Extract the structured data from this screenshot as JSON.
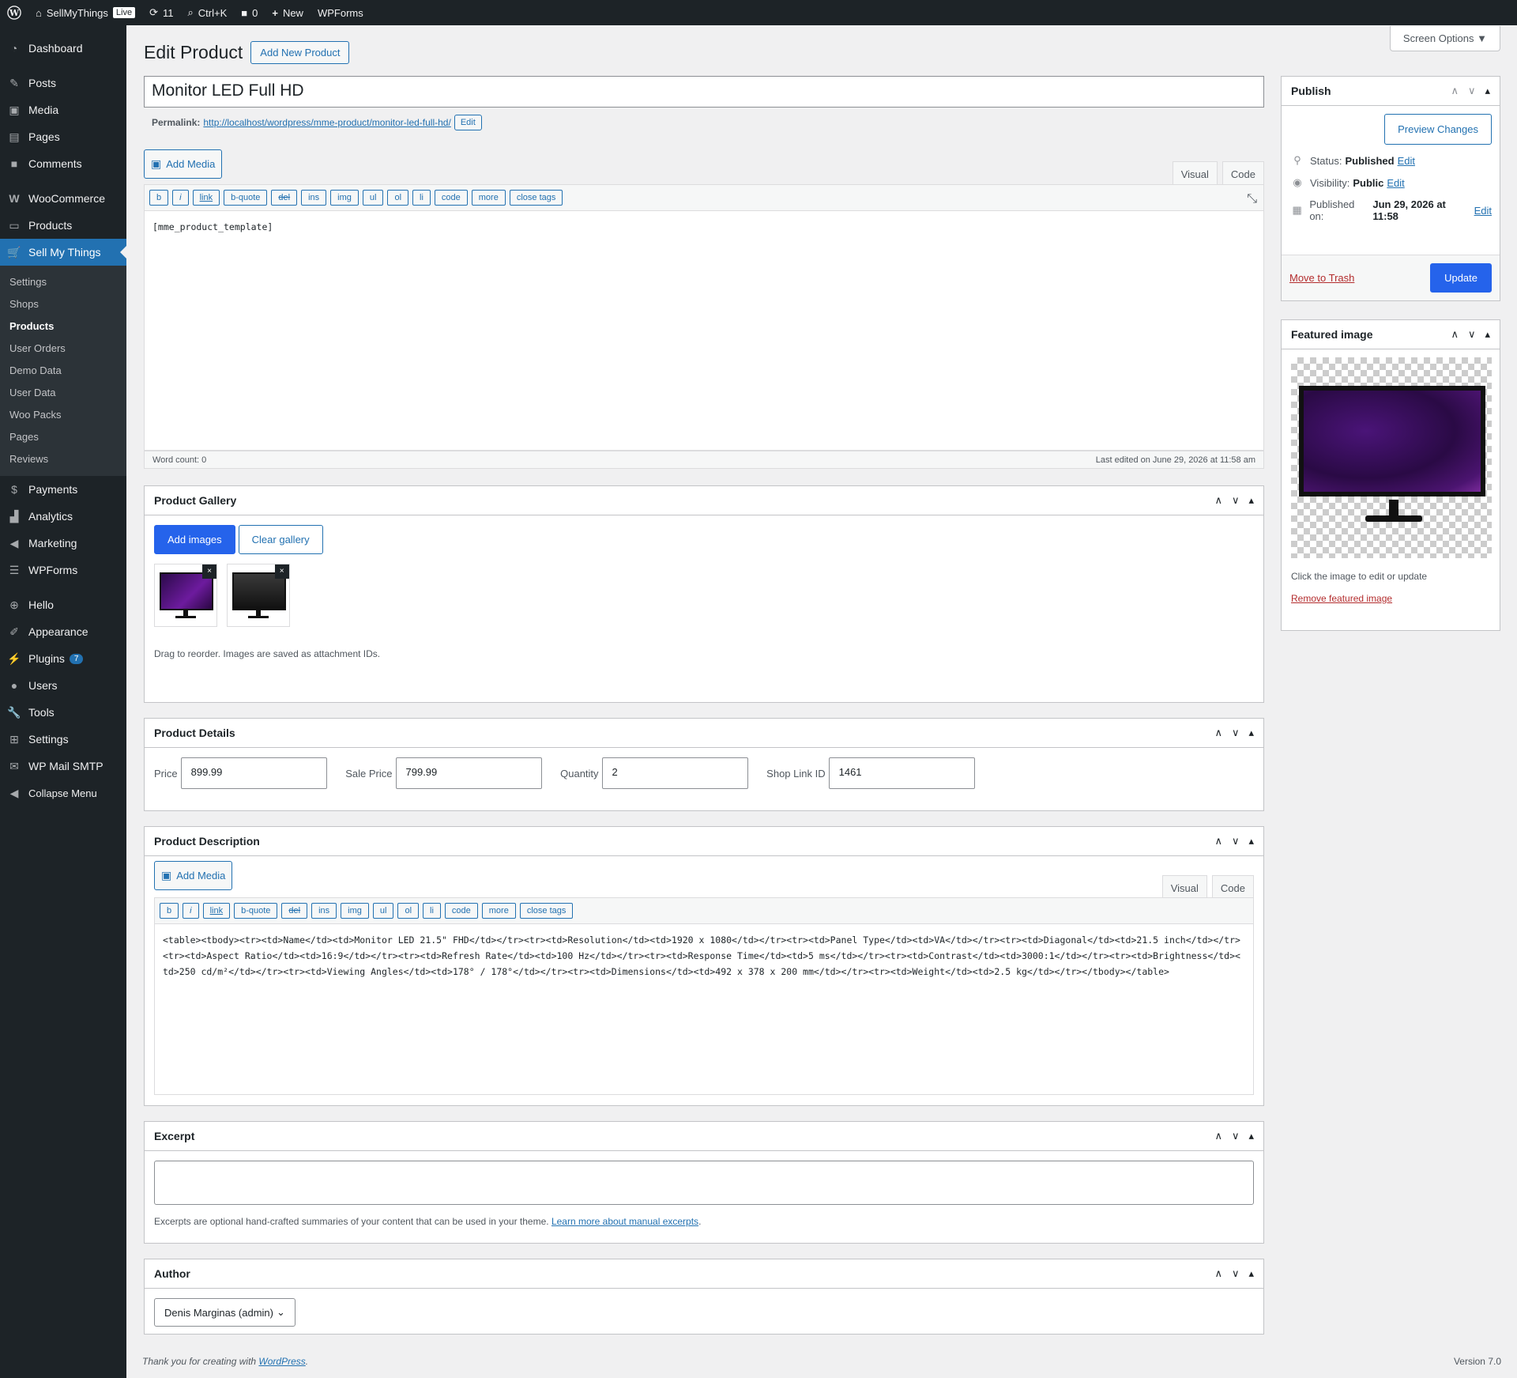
{
  "adminbar": {
    "site_name": "SellMyThings",
    "live": "Live",
    "updates": "11",
    "search": "Ctrl+K",
    "comments": "0",
    "new": "New",
    "wpforms": "WPForms"
  },
  "sidebar": {
    "dashboard": "Dashboard",
    "posts": "Posts",
    "media": "Media",
    "pages": "Pages",
    "comments": "Comments",
    "woocommerce": "WooCommerce",
    "products": "Products",
    "sell_my_things": "Sell My Things",
    "submenu": [
      "Settings",
      "Shops",
      "Products",
      "User Orders",
      "Demo Data",
      "User Data",
      "Woo Packs",
      "Pages",
      "Reviews"
    ],
    "payments": "Payments",
    "analytics": "Analytics",
    "marketing": "Marketing",
    "wpforms": "WPForms",
    "hello": "Hello",
    "appearance": "Appearance",
    "plugins": "Plugins",
    "plugins_badge": "7",
    "users": "Users",
    "tools": "Tools",
    "settings": "Settings",
    "wp_mail_smtp": "WP Mail SMTP",
    "collapse": "Collapse Menu"
  },
  "header": {
    "screen_options": "Screen Options ▼",
    "title": "Edit Product",
    "add_new": "Add New Product"
  },
  "product": {
    "title": "Monitor LED Full HD",
    "permalink_label": "Permalink:",
    "permalink_url": "http://localhost/wordpress/mme-product/monitor-led-full-hd/",
    "permalink_edit": "Edit"
  },
  "editor": {
    "add_media": "Add Media",
    "tab_visual": "Visual",
    "tab_code": "Code",
    "qt_buttons": [
      "b",
      "i",
      "link",
      "b-quote",
      "del",
      "ins",
      "img",
      "ul",
      "ol",
      "li",
      "code",
      "more",
      "close tags"
    ],
    "content": "[mme_product_template]",
    "word_count": "Word count: 0",
    "last_edited": "Last edited on June 29, 2026 at 11:58 am"
  },
  "gallery": {
    "title": "Product Gallery",
    "add_images": "Add images",
    "clear_gallery": "Clear gallery",
    "hint": "Drag to reorder. Images are saved as attachment IDs."
  },
  "details": {
    "title": "Product Details",
    "price_label": "Price",
    "price": "899.99",
    "sale_label": "Sale Price",
    "sale": "799.99",
    "qty_label": "Quantity",
    "qty": "2",
    "shop_label": "Shop Link ID",
    "shop": "1461"
  },
  "description": {
    "title": "Product Description",
    "add_media": "Add Media",
    "tab_visual": "Visual",
    "tab_code": "Code",
    "content": "<table><tbody><tr><td>Name</td><td>Monitor LED 21.5\" FHD</td></tr><tr><td>Resolution</td><td>1920 x 1080</td></tr><tr><td>Panel Type</td><td>VA</td></tr><tr><td>Diagonal</td><td>21.5 inch</td></tr><tr><td>Aspect Ratio</td><td>16:9</td></tr><tr><td>Refresh Rate</td><td>100 Hz</td></tr><tr><td>Response Time</td><td>5 ms</td></tr><tr><td>Contrast</td><td>3000:1</td></tr><tr><td>Brightness</td><td>250 cd/m²</td></tr><tr><td>Viewing Angles</td><td>178° / 178°</td></tr><tr><td>Dimensions</td><td>492 x 378 x 200 mm</td></tr><tr><td>Weight</td><td>2.5 kg</td></tr></tbody></table>"
  },
  "excerpt": {
    "title": "Excerpt",
    "hint": "Excerpts are optional hand-crafted summaries of your content that can be used in your theme.",
    "link": "Learn more about manual excerpts"
  },
  "author": {
    "title": "Author",
    "value": "Denis Marginas (admin)"
  },
  "publish": {
    "title": "Publish",
    "preview": "Preview Changes",
    "status_label": "Status:",
    "status": "Published",
    "visibility_label": "Visibility:",
    "visibility": "Public",
    "published_label": "Published on:",
    "published": "Jun 29, 2026 at 11:58",
    "edit": "Edit",
    "trash": "Move to Trash",
    "update": "Update"
  },
  "featured": {
    "title": "Featured image",
    "hint": "Click the image to edit or update",
    "remove": "Remove featured image"
  },
  "footer": {
    "thanks": "Thank you for creating with",
    "wp": "WordPress",
    "version": "Version 7.0"
  }
}
